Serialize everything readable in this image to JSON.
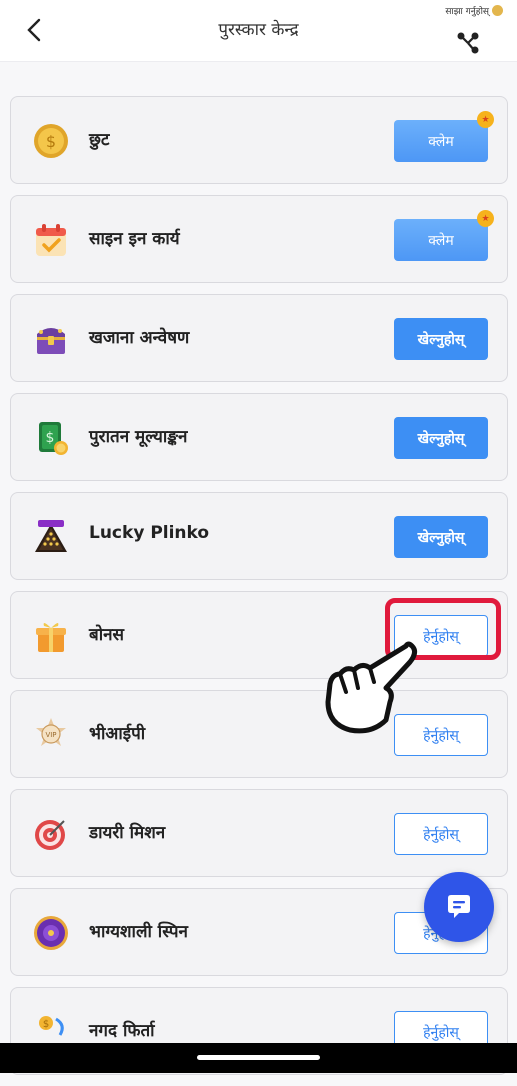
{
  "header": {
    "title": "पुरस्कार केन्द्र",
    "share_label": "साझा गर्नुहोस्"
  },
  "items": [
    {
      "label": "छुट",
      "button": "क्लेम",
      "icon": "gold-coin-icon"
    },
    {
      "label": "साइन इन कार्य",
      "button": "क्लेम",
      "icon": "calendar-check-icon"
    },
    {
      "label": "खजाना अन्वेषण",
      "button": "खेल्नुहोस्",
      "icon": "treasure-chest-icon"
    },
    {
      "label": "पुरातन मूल्याङ्कन",
      "button": "खेल्नुहोस्",
      "icon": "money-card-icon"
    },
    {
      "label": "Lucky Plinko",
      "button": "खेल्नुहोस्",
      "icon": "plinko-icon"
    },
    {
      "label": "बोनस",
      "button": "हेर्नुहोस्",
      "icon": "gift-box-icon"
    },
    {
      "label": "भीआईपी",
      "button": "हेर्नुहोस्",
      "icon": "vip-badge-icon"
    },
    {
      "label": "डायरी मिशन",
      "button": "हेर्नुहोस्",
      "icon": "target-icon"
    },
    {
      "label": "भाग्यशाली स्पिन",
      "button": "हेर्नुहोस्",
      "icon": "spin-wheel-icon"
    },
    {
      "label": "नगद फिर्ता",
      "button": "हेर्नुहोस्",
      "icon": "cashback-icon"
    }
  ],
  "colors": {
    "accent": "#3d8ff4",
    "highlight": "#e01a3c",
    "chat": "#2f55e8"
  }
}
